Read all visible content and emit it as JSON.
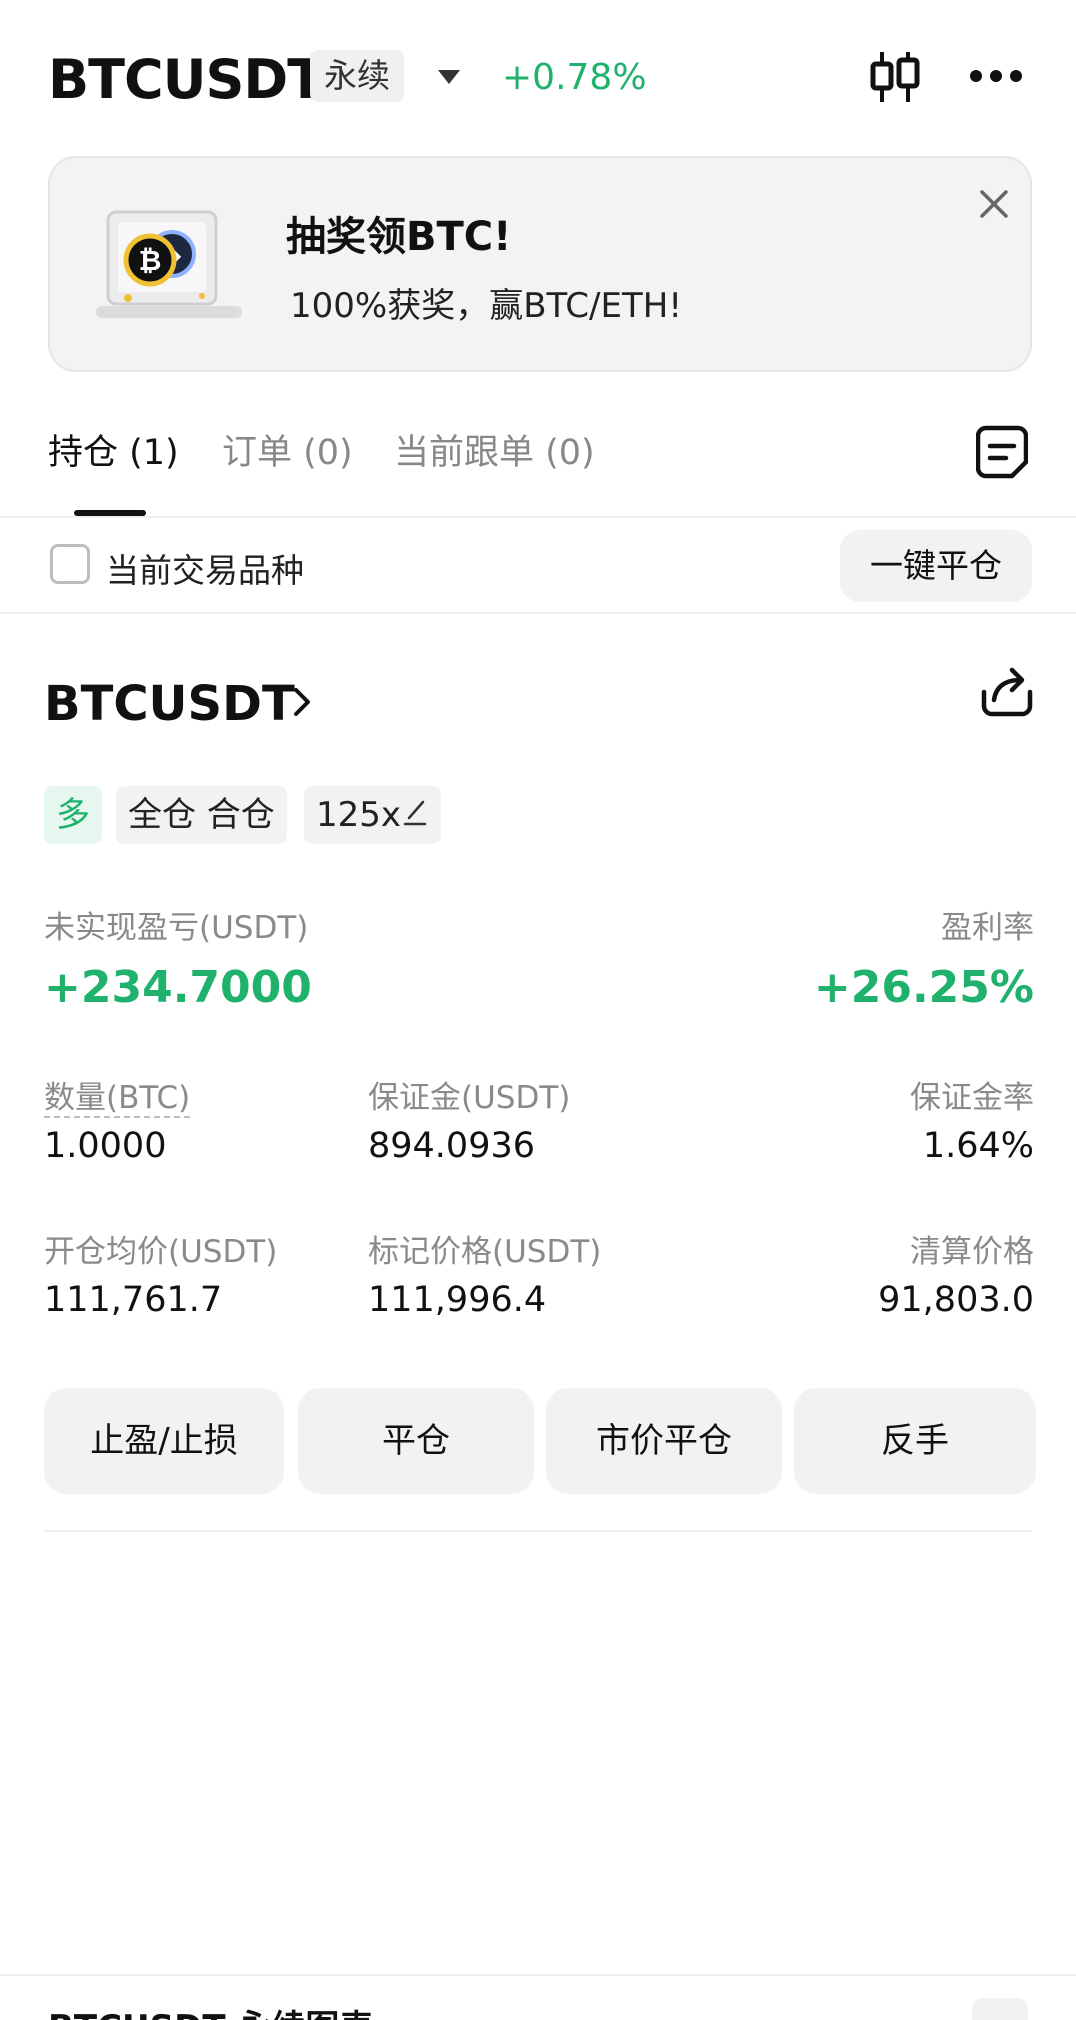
{
  "header": {
    "symbol": "BTCUSDT",
    "contract_type": "永续",
    "change_pct": "+0.78%"
  },
  "banner": {
    "title": "抽奖领BTC!",
    "subtitle": "100%获奖，赢BTC/ETH!"
  },
  "tabs": [
    {
      "label": "持仓 (1)"
    },
    {
      "label": "订单 (0)"
    },
    {
      "label": "当前跟单 (0)"
    }
  ],
  "filter": {
    "checkbox_label": "当前交易品种",
    "close_all_label": "一键平仓"
  },
  "position": {
    "symbol": "BTCUSDT",
    "tags": {
      "side": "多",
      "margin_mode": "全仓 合仓",
      "leverage": "125x"
    },
    "unrealized_pnl_label": "未实现盈亏(USDT)",
    "unrealized_pnl_value": "+234.7000",
    "roe_label": "盈利率",
    "roe_value": "+26.25%",
    "qty_label": "数量(BTC)",
    "qty_value": "1.0000",
    "margin_label": "保证金(USDT)",
    "margin_value": "894.0936",
    "margin_rate_label": "保证金率",
    "margin_rate_value": "1.64%",
    "entry_label": "开仓均价(USDT)",
    "entry_value": "111,761.7",
    "mark_label": "标记价格(USDT)",
    "mark_value": "111,996.4",
    "liq_label": "清算价格",
    "liq_value": "91,803.0"
  },
  "actions": {
    "tp_sl": "止盈/止损",
    "close": "平仓",
    "market_close": "市价平仓",
    "reverse": "反手"
  },
  "bottom": {
    "title": "BTCUSDT 永续图表"
  },
  "colors": {
    "up_green": "#20b26c",
    "text_primary": "#111111",
    "text_secondary": "#8a8a8a",
    "button_bg": "#f2f2f2"
  },
  "icons": [
    "chevron-down-icon",
    "candlestick-icon",
    "more-icon",
    "close-icon",
    "notes-icon",
    "chevron-right-icon",
    "share-icon",
    "edit-icon"
  ]
}
